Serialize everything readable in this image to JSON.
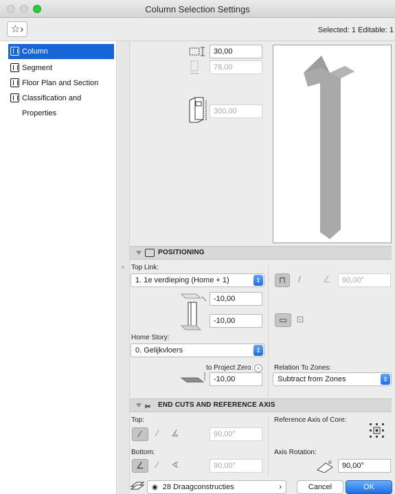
{
  "window": {
    "title": "Column Selection Settings"
  },
  "toolbar": {
    "favorites_glyph": "☆›",
    "selected_info": "Selected: 1 Editable: 1"
  },
  "sidebar": {
    "items": [
      {
        "label": "Column",
        "icon": "column-icon",
        "active": true
      },
      {
        "label": "Segment",
        "icon": "segment-icon",
        "active": false
      },
      {
        "label": "Floor Plan and Section",
        "icon": "floor-plan-icon",
        "active": false
      },
      {
        "label": "Classification and Properties",
        "icon": "classification-icon",
        "active": false
      }
    ]
  },
  "dimensions": {
    "width": "30,00",
    "depth": "78,00",
    "height": "300,00"
  },
  "positioning": {
    "title": "POSITIONING",
    "top_link_label": "Top Link:",
    "top_link_value": "1. 1e verdieping (Home + 1)",
    "top_offset": "-10,00",
    "bottom_offset": "-10,00",
    "angle": "90,00°",
    "home_story_label": "Home Story:",
    "home_story_value": "0. Gelijkvloers",
    "to_project_zero_label": "to Project Zero",
    "to_project_zero_value": "-10,00",
    "relation_label": "Relation To Zones:",
    "relation_value": "Subtract from Zones"
  },
  "end_cuts": {
    "title": "END CUTS AND REFERENCE AXIS",
    "top_label": "Top:",
    "top_angle": "90,00°",
    "bottom_label": "Bottom:",
    "bottom_angle": "90,00°",
    "reference_axis_label": "Reference Axis of Core:",
    "axis_rotation_label": "Axis Rotation:",
    "axis_rotation_value": "90,00°"
  },
  "footer": {
    "layer_value": "28 Draagconstructies",
    "cancel_label": "Cancel",
    "ok_label": "OK"
  },
  "colors": {
    "accent": "#1865d8",
    "preview_column": "#a9a9a9"
  }
}
